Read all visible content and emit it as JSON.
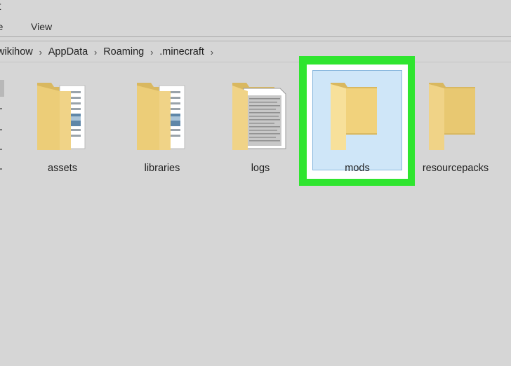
{
  "window": {
    "title_fragment": "t"
  },
  "ribbon": {
    "tabs": [
      {
        "label": "re"
      },
      {
        "label": "View"
      }
    ]
  },
  "address_bar": {
    "crumbs": [
      "wikihow",
      "AppData",
      "Roaming",
      ".minecraft"
    ],
    "separator": "›"
  },
  "content": {
    "items": [
      {
        "label": "assets",
        "icon": "folder-with-documents-icon",
        "selected": false
      },
      {
        "label": "libraries",
        "icon": "folder-with-documents-icon",
        "selected": false
      },
      {
        "label": "logs",
        "icon": "folder-with-text-file-icon",
        "selected": false
      },
      {
        "label": "mods",
        "icon": "empty-folder-icon",
        "selected": true
      },
      {
        "label": "resourcepacks",
        "icon": "empty-folder-icon",
        "selected": false
      }
    ]
  },
  "colors": {
    "background": "#d6d6d6",
    "selection_fill": "#cfe6f8",
    "selection_border": "#8ab8de",
    "highlight_ring": "#2fe52f",
    "folder_back": "#d9b860",
    "folder_front": "#f3d88a"
  }
}
